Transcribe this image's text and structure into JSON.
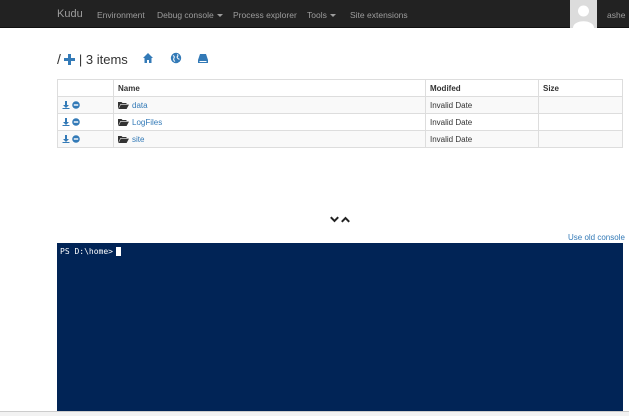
{
  "navbar": {
    "brand": "Kudu",
    "items": [
      {
        "label": "Environment"
      },
      {
        "label": "Debug console"
      },
      {
        "label": "Process explorer"
      },
      {
        "label": "Tools"
      },
      {
        "label": "Site extensions"
      }
    ],
    "user": "ashe"
  },
  "path": {
    "slash": "/",
    "count_text": "| 3 items"
  },
  "icons": {
    "add": "plus-icon",
    "home": "home-icon",
    "globe": "globe-icon",
    "drive": "drive-icon",
    "download": "download-icon",
    "delete": "minus-circle-icon",
    "folder": "folder-open-icon",
    "expand": "chevron-down-icon",
    "collapse": "chevron-up-icon"
  },
  "table": {
    "headers": {
      "name": "Name",
      "modified": "Modifed",
      "size": "Size"
    },
    "rows": [
      {
        "name": "data",
        "modified": "Invalid Date",
        "size": ""
      },
      {
        "name": "LogFiles",
        "modified": "Invalid Date",
        "size": ""
      },
      {
        "name": "site",
        "modified": "Invalid Date",
        "size": ""
      }
    ]
  },
  "console": {
    "old_console_link": "Use old console",
    "prompt": "PS D:\\home>"
  },
  "colors": {
    "accent": "#337ab7",
    "navbar": "#222222",
    "console_bg": "#012456"
  }
}
